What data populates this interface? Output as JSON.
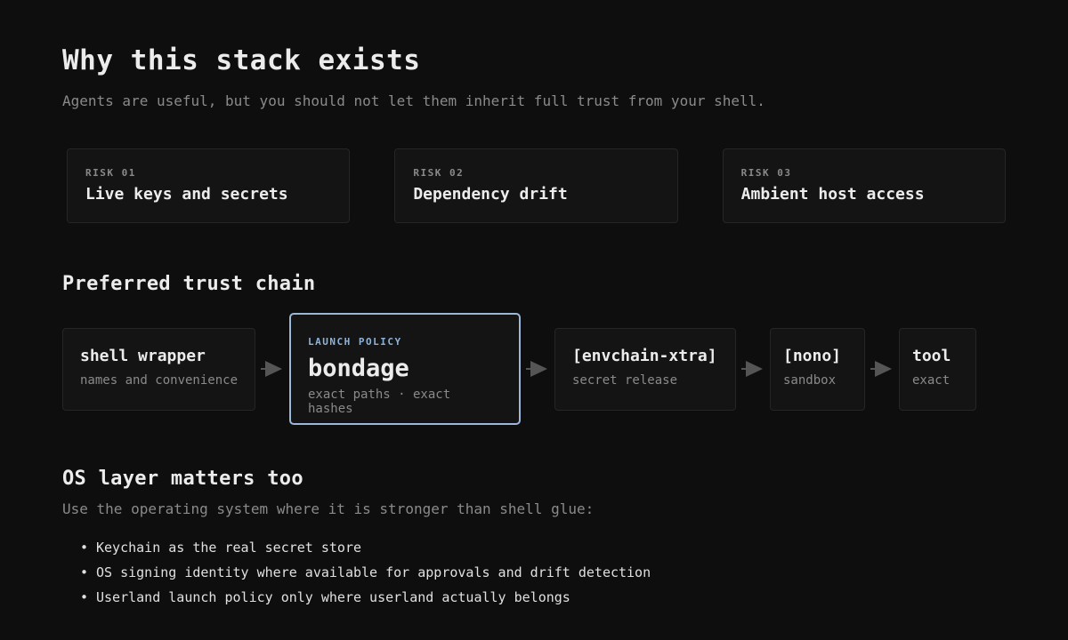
{
  "header": {
    "title": "Why this stack exists",
    "subtitle": "Agents are useful, but you should not let them inherit full trust from your shell."
  },
  "risks": [
    {
      "tag": "RISK 01",
      "title": "Live keys and secrets"
    },
    {
      "tag": "RISK 02",
      "title": "Dependency drift"
    },
    {
      "tag": "RISK 03",
      "title": "Ambient host access"
    }
  ],
  "trust_chain": {
    "title": "Preferred trust chain",
    "nodes": [
      {
        "name": "shell wrapper",
        "sub": "names and convenience"
      },
      {
        "tag": "LAUNCH POLICY",
        "name": "bondage",
        "sub": "exact paths · exact hashes"
      },
      {
        "name": "[envchain-xtra]",
        "sub": "secret release"
      },
      {
        "name": "[nono]",
        "sub": "sandbox"
      },
      {
        "name": "tool",
        "sub": "exact"
      }
    ]
  },
  "os_layer": {
    "title": "OS layer matters too",
    "subtitle": "Use the operating system where it is stronger than shell glue:",
    "bullet_glyph": "•",
    "bullets": [
      "Keychain as the real secret store",
      "OS signing identity where available for approvals and drift detection",
      "Userland launch policy only where userland actually belongs"
    ]
  },
  "colors": {
    "background": "#0e0e0e",
    "card": "#141414",
    "border": "#262626",
    "muted_text": "#8a8a8a",
    "accent": "#9bb8d9",
    "arrow": "#555555"
  },
  "icons": {
    "chain_arrow": "arrow-right-icon"
  }
}
